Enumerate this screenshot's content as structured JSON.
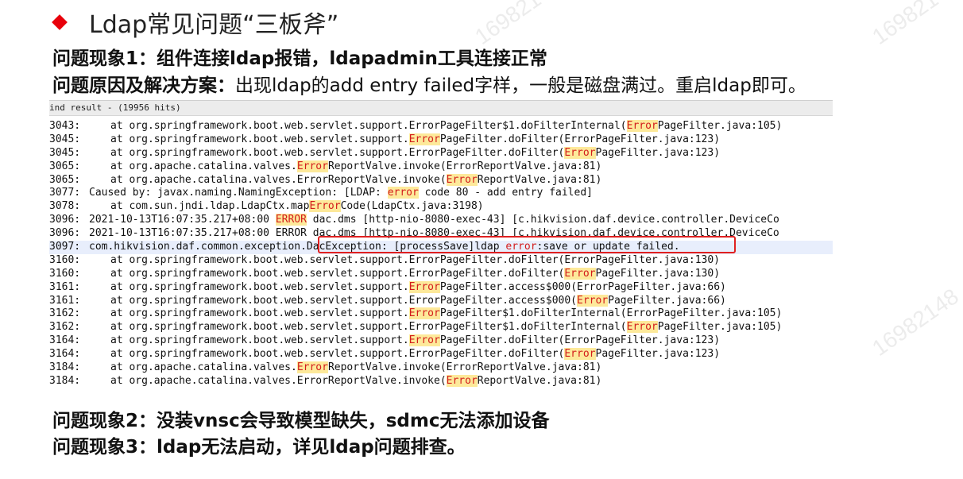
{
  "watermark": "16982148",
  "title": "Ldap常见问题“三板斧”",
  "issue1": {
    "label": "问题现象1：",
    "text": "组件连接ldap报错，ldapadmin工具连接正常"
  },
  "issue1_cause": {
    "label": "问题原因及解决方案：",
    "text": "出现ldap的add entry failed字样，一般是磁盘满过。重启ldap即可。"
  },
  "issue2": {
    "label": "问题现象2：",
    "text": "没装vnsc会导致模型缺失，sdmc无法添加设备"
  },
  "issue3": {
    "label": "问题现象3：",
    "text": "ldap无法启动，详见ldap问题排查。"
  },
  "log": {
    "header": "ind result - (19956 hits)",
    "rows": [
      {
        "num": "3043:",
        "pre": "at org.springframework.boot.web.servlet.support.ErrorPageFilter$1.doFilterInternal(",
        "hit": "Error",
        "post": "PageFilter.java:105)"
      },
      {
        "num": "3045:",
        "pre": "at org.springframework.boot.web.servlet.support.",
        "hit": "Error",
        "post": "PageFilter.doFilter(ErrorPageFilter.java:123)"
      },
      {
        "num": "3045:",
        "pre": "at org.springframework.boot.web.servlet.support.ErrorPageFilter.doFilter(",
        "hit": "Error",
        "post": "PageFilter.java:123)"
      },
      {
        "num": "3065:",
        "pre": "at org.apache.catalina.valves.",
        "hit": "Error",
        "post": "ReportValve.invoke(ErrorReportValve.java:81)"
      },
      {
        "num": "3065:",
        "pre": "at org.apache.catalina.valves.ErrorReportValve.invoke(",
        "hit": "Error",
        "post": "ReportValve.java:81)"
      },
      {
        "num": "3077:",
        "pre": "Caused by: javax.naming.NamingException: [LDAP: ",
        "hit": "error",
        "post": " code 80 - add entry failed]"
      },
      {
        "num": "3078:",
        "pre": "at com.sun.jndi.ldap.LdapCtx.map",
        "hit": "Error",
        "post": "Code(LdapCtx.java:3198)"
      },
      {
        "num": "3096:",
        "pre": "2021-10-13T16:07:35.217+08:00 ",
        "hit": "ERROR",
        "post": " dac.dms [http-nio-8080-exec-43] [c.hikvision.daf.device.controller.DeviceCo"
      },
      {
        "num": "3096:",
        "pre": "2021-10-13T16:07:35.217+08:00 ERROR dac.dms [http-nio-8080-exec-43] [c.hikvision.daf.device.controller.DeviceCo",
        "hit": "",
        "post": ""
      },
      {
        "num": "3097:",
        "pre": "com.hikvision.daf.common.exception.DacException: [processSave]ldap ",
        "err": "error",
        "post": ":save or update failed."
      },
      {
        "num": "3160:",
        "pre": "at org.springframework.boot.web.servlet.support.ErrorPageFilter.doFilter(ErrorPageFilter.java:130)",
        "hit": "",
        "post": ""
      },
      {
        "num": "3160:",
        "pre": "at org.springframework.boot.web.servlet.support.ErrorPageFilter.doFilter(",
        "hit": "Error",
        "post": "PageFilter.java:130)"
      },
      {
        "num": "3161:",
        "pre": "at org.springframework.boot.web.servlet.support.",
        "hit": "Error",
        "post": "PageFilter.access$000(ErrorPageFilter.java:66)"
      },
      {
        "num": "3161:",
        "pre": "at org.springframework.boot.web.servlet.support.ErrorPageFilter.access$000(",
        "hit": "Error",
        "post": "PageFilter.java:66)"
      },
      {
        "num": "3162:",
        "pre": "at org.springframework.boot.web.servlet.support.",
        "hit": "Error",
        "post": "PageFilter$1.doFilterInternal(ErrorPageFilter.java:105)"
      },
      {
        "num": "3162:",
        "pre": "at org.springframework.boot.web.servlet.support.ErrorPageFilter$1.doFilterInternal(",
        "hit": "Error",
        "post": "PageFilter.java:105)"
      },
      {
        "num": "3164:",
        "pre": "at org.springframework.boot.web.servlet.support.",
        "hit": "Error",
        "post": "PageFilter.doFilter(ErrorPageFilter.java:123)"
      },
      {
        "num": "3164:",
        "pre": "at org.springframework.boot.web.servlet.support.ErrorPageFilter.doFilter(",
        "hit": "Error",
        "post": "PageFilter.java:123)"
      },
      {
        "num": "3184:",
        "pre": "at org.apache.catalina.valves.",
        "hit": "Error",
        "post": "ReportValve.invoke(ErrorReportValve.java:81)"
      },
      {
        "num": "3184:",
        "pre": "at org.apache.catalina.valves.ErrorReportValve.invoke(",
        "hit": "Error",
        "post": "ReportValve.java:81)"
      }
    ]
  },
  "colors": {
    "accent_red": "#e8000b",
    "hit_bg": "#fde99a",
    "hit_fg": "#d31c1c",
    "row_highlight": "#e8eefc"
  }
}
